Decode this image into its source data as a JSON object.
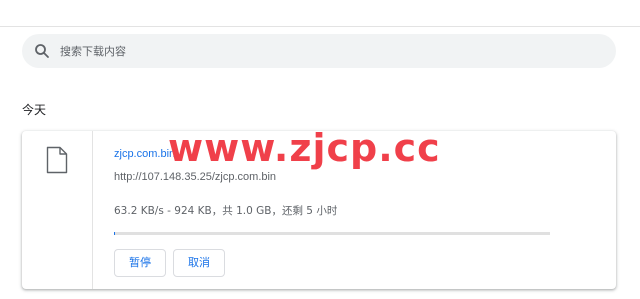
{
  "search": {
    "placeholder": "搜索下载内容",
    "icon": "search-icon"
  },
  "section": {
    "date_label": "今天"
  },
  "download": {
    "file_icon": "file-icon",
    "file_name": "zjcp.com.bin",
    "url": "http://107.148.35.25/zjcp.com.bin",
    "status": "63.2 KB/s - 924 KB，共 1.0 GB，还剩 5 小时",
    "progress_fraction": 0.0009,
    "pause_label": "暂停",
    "cancel_label": "取消"
  },
  "watermark": {
    "text": "www.zjcp.cc"
  },
  "colors": {
    "accent": "#1a73e8",
    "watermark": "#f0404a",
    "search_background": "#f1f3f4"
  }
}
